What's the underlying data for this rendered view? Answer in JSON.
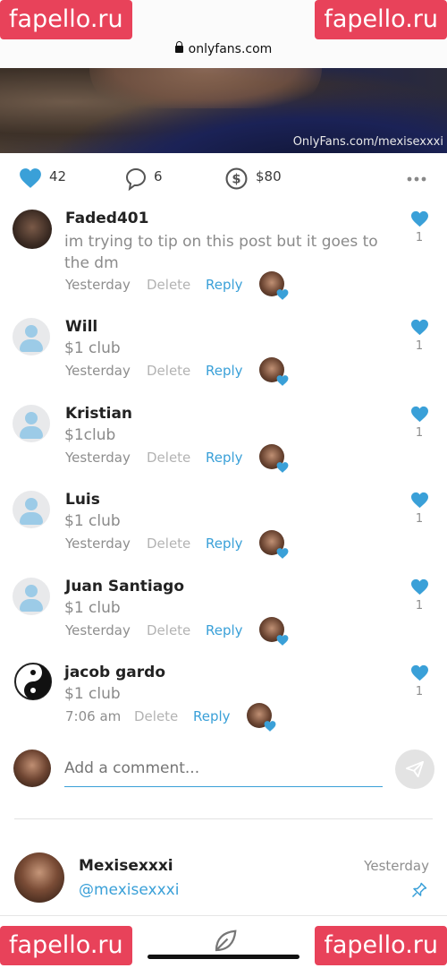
{
  "browser": {
    "url": "onlyfans.com"
  },
  "post": {
    "image_watermark": "OnlyFans.com/mexisexxxi",
    "stats": {
      "likes": "42",
      "comments": "6",
      "tips": "$80"
    }
  },
  "watermark_badge": "fapello.ru",
  "comments": [
    {
      "name": "Faded401",
      "text": "im trying to tip on this post but it goes to the dm",
      "time": "Yesterday",
      "delete": "Delete",
      "reply": "Reply",
      "likes": "1"
    },
    {
      "name": "Will",
      "text": "$1 club",
      "time": "Yesterday",
      "delete": "Delete",
      "reply": "Reply",
      "likes": "1"
    },
    {
      "name": "Kristian",
      "text": "$1club",
      "time": "Yesterday",
      "delete": "Delete",
      "reply": "Reply",
      "likes": "1"
    },
    {
      "name": "Luis",
      "text": "$1 club",
      "time": "Yesterday",
      "delete": "Delete",
      "reply": "Reply",
      "likes": "1"
    },
    {
      "name": "Juan Santiago",
      "text": "$1 club",
      "time": "Yesterday",
      "delete": "Delete",
      "reply": "Reply",
      "likes": "1"
    },
    {
      "name": "jacob gardo",
      "text": "$1 club",
      "time": "7:06 am",
      "delete": "Delete",
      "reply": "Reply",
      "likes": "1"
    }
  ],
  "add_comment": {
    "placeholder": "Add a comment..."
  },
  "profile": {
    "name": "Mexisexxxi",
    "handle": "@mexisexxxi",
    "time": "Yesterday"
  },
  "colors": {
    "accent": "#3aa0d8",
    "heart": "#3aa0d8",
    "badge": "#e8425a"
  }
}
